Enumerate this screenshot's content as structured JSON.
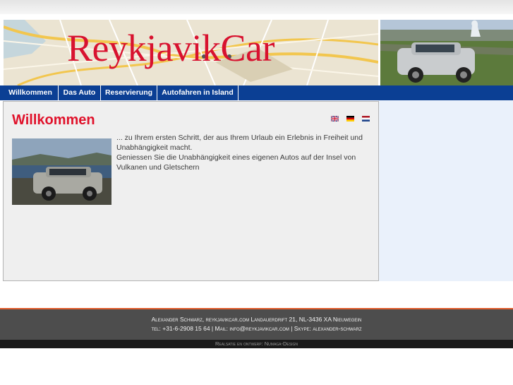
{
  "site": {
    "title": "ReykjavikCar"
  },
  "nav": {
    "items": [
      {
        "label": "Willkommen"
      },
      {
        "label": "Das Auto"
      },
      {
        "label": "Reservierung"
      },
      {
        "label": "Autofahren in Island"
      }
    ]
  },
  "main": {
    "heading": "Willkommen",
    "paragraph1": "... zu Ihrem ersten Schritt, der aus Ihrem Urlaub ein Erlebnis in Freiheit und Unabhängigkeit macht.",
    "paragraph2": "Geniessen Sie die Unabhängigkeit eines eigenen Autos auf der Insel von Vulkanen und Gletschern",
    "languages": [
      "English",
      "Deutsch",
      "Nederlands"
    ]
  },
  "footer": {
    "line1": "Alexander Schwarz, reykjavikcar.com Landauerdrift 21, NL-3436 XA Nieuwegein",
    "line2": "tel: +31-6-2908 15 64 | Mail: info@reykjavikcar.com | Skype: alexander-schwarz",
    "credit": "Realsatie en ontwerp: Numaga-Design"
  },
  "colors": {
    "nav_bg": "#0b3f94",
    "title_red": "#e0122b",
    "footer_bg": "#4d4d4d",
    "accent_line": "#e05a2a"
  }
}
